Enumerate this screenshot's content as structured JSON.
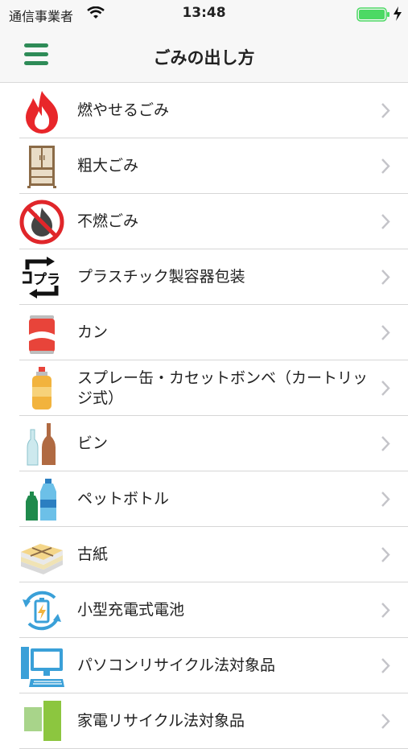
{
  "status_bar": {
    "carrier": "通信事業者",
    "time": "13:48",
    "wifi_icon": "wifi-icon",
    "battery_icon": "battery-icon",
    "charging_icon": "charging-icon"
  },
  "nav": {
    "title": "ごみの出し方",
    "menu_icon": "hamburger-menu-icon",
    "accent_color": "#2e8b57"
  },
  "items": [
    {
      "label": "燃やせるごみ",
      "icon": "fire-icon"
    },
    {
      "label": "粗大ごみ",
      "icon": "cabinet-icon"
    },
    {
      "label": "不燃ごみ",
      "icon": "no-fire-icon"
    },
    {
      "label": "プラスチック製容器包装",
      "icon": "plastic-recycle-icon"
    },
    {
      "label": "カン",
      "icon": "can-icon"
    },
    {
      "label": "スプレー缶・カセットボンベ（カートリッジ式）",
      "icon": "spray-can-icon"
    },
    {
      "label": "ビン",
      "icon": "bottles-icon"
    },
    {
      "label": "ペットボトル",
      "icon": "pet-bottle-icon"
    },
    {
      "label": "古紙",
      "icon": "newspaper-icon"
    },
    {
      "label": "小型充電式電池",
      "icon": "rechargeable-battery-icon"
    },
    {
      "label": "パソコンリサイクル法対象品",
      "icon": "computer-icon"
    },
    {
      "label": "家電リサイクル法対象品",
      "icon": "appliance-icon"
    }
  ]
}
